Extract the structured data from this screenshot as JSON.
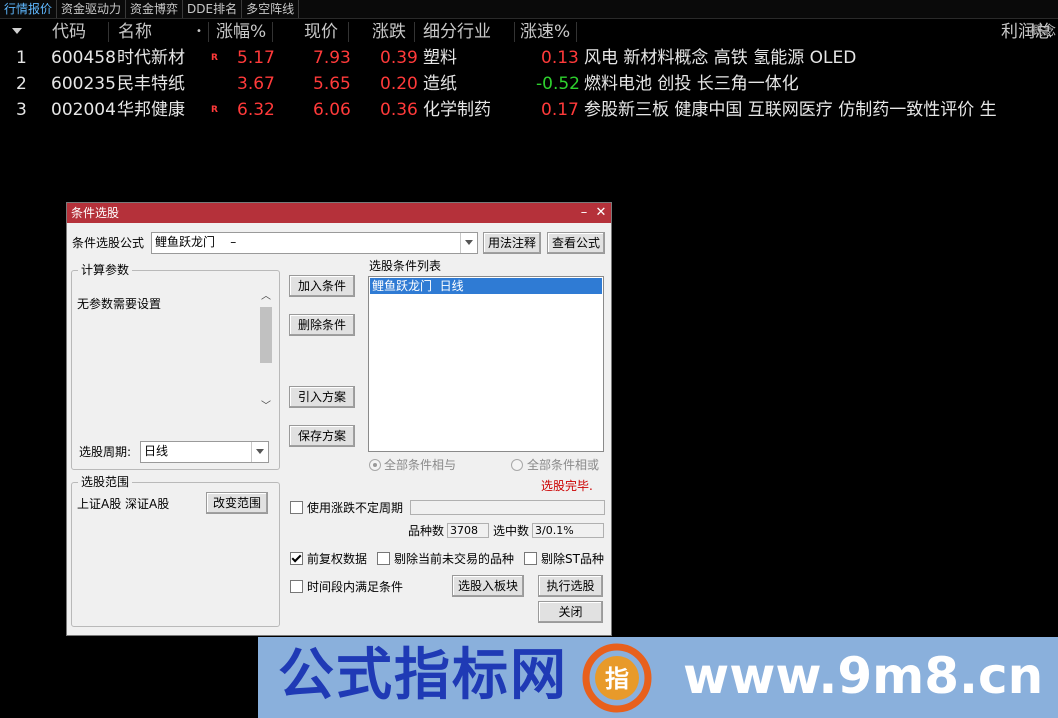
{
  "tabs": [
    "行情报价",
    "资金驱动力",
    "资金博弈",
    "DDE排名",
    "多空阵线"
  ],
  "active_tab": 0,
  "grid": {
    "headers": {
      "code": "代码",
      "name": "名称",
      "name_dot": "•",
      "change_pct": "涨幅%",
      "price": "现价",
      "change": "涨跌",
      "industry": "细分行业",
      "speed": "涨速%",
      "profit": "利润总",
      "overlay": "概念"
    },
    "rows": [
      {
        "idx": "1",
        "code": "600458",
        "name": "时代新材",
        "badge": "R",
        "change_pct": "5.17",
        "price": "7.93",
        "change": "0.39",
        "industry": "塑料",
        "speed": "0.13",
        "concepts": "风电 新材料概念 高铁 氢能源 OLED"
      },
      {
        "idx": "2",
        "code": "600235",
        "name": "民丰特纸",
        "badge": "",
        "change_pct": "3.67",
        "price": "5.65",
        "change": "0.20",
        "industry": "造纸",
        "speed": "-0.52",
        "concepts": "燃料电池 创投 长三角一体化"
      },
      {
        "idx": "3",
        "code": "002004",
        "name": "华邦健康",
        "badge": "R",
        "change_pct": "6.32",
        "price": "6.06",
        "change": "0.36",
        "industry": "化学制药",
        "speed": "0.17",
        "concepts": "参股新三板 健康中国 互联网医疗 仿制药一致性评价 生"
      }
    ]
  },
  "dialog": {
    "title": "条件选股",
    "formula_label": "条件选股公式",
    "formula_value": "鲤鱼跃龙门    –",
    "usage_button": "用法注释",
    "view_button": "查看公式",
    "params_group": "计算参数",
    "no_params_text": "无参数需要设置",
    "period_label": "选股周期:",
    "period_value": "日线",
    "scope_group": "选股范围",
    "scope_text": "上证A股  深证A股",
    "change_scope_button": "改变范围",
    "add_condition_button": "加入条件",
    "delete_condition_button": "删除条件",
    "import_plan_button": "引入方案",
    "save_plan_button": "保存方案",
    "condition_list_label": "选股条件列表",
    "condition_items": [
      "鲤鱼跃龙门  日线"
    ],
    "radio_and": "全部条件相与",
    "radio_or": "全部条件相或",
    "status_text": "选股完毕.",
    "use_period_check": "使用涨跌不定周期",
    "count_label": "品种数",
    "count_value": "3708",
    "selected_label": "选中数",
    "selected_value": "3/0.1%",
    "restore_check": "前复权数据",
    "exclude_untraded_check": "剔除当前未交易的品种",
    "exclude_st_check": "剔除ST品种",
    "time_range_check": "时间段内满足条件",
    "to_block_button": "选股入板块",
    "execute_button": "执行选股",
    "close_button": "关闭",
    "checks": {
      "use_period": false,
      "restore": true,
      "exclude_untraded": false,
      "exclude_st": false,
      "time_range": false
    },
    "radio_selected": "and"
  },
  "banner": {
    "title": "公式指标网",
    "url": "www.9m8.cn",
    "logo_char": "指"
  },
  "colors": {
    "up": "#ff3a3a",
    "down": "#2ed12e",
    "title_bar": "#b5313a",
    "selection": "#2f7bd4",
    "status": "#cc0000",
    "banner_bg": "#8ab0dc",
    "banner_title": "#1f3ab5"
  }
}
